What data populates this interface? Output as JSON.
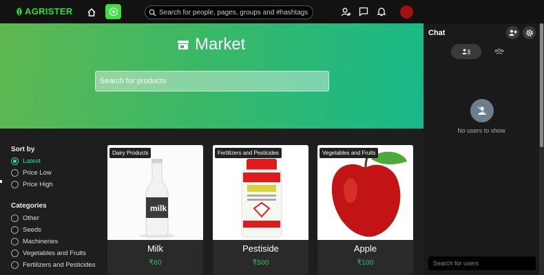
{
  "topbar": {
    "logo_text": "AGRISTER",
    "search_placeholder": "Search for people, pages, groups and #hashtags"
  },
  "hero": {
    "title": "Market",
    "search_placeholder": "Search for products"
  },
  "filters": {
    "sort_title": "Sort by",
    "sort_options": [
      "Latest",
      "Price Low",
      "Price High"
    ],
    "sort_selected": "Latest",
    "categories_title": "Categories",
    "categories": [
      "Other",
      "Seeds",
      "Machineries",
      "Vegetables and Fruits",
      "Fertilizers and Pesticides"
    ]
  },
  "products": [
    {
      "category": "Dairy Products",
      "name": "Milk",
      "price": "₹60"
    },
    {
      "category": "Fertilizers and Pesticides",
      "name": "Pestiside",
      "price": "₹500"
    },
    {
      "category": "Vegetables and Fruits",
      "name": "Apple",
      "price": "₹100"
    }
  ],
  "chat": {
    "title": "Chat",
    "empty_text": "No users to show",
    "search_placeholder": "Search for users"
  },
  "colors": {
    "brand_green": "#2ee02e",
    "accent_teal": "#2ee0a0",
    "price_green": "#2ec060",
    "avatar_red": "#a50f0f"
  },
  "icons": [
    "home-icon",
    "plus-circle-icon",
    "search-icon",
    "add-user-icon",
    "message-icon",
    "bell-icon",
    "store-icon",
    "group-add-icon",
    "gear-icon",
    "contacts-icon",
    "groups-icon",
    "no-user-icon"
  ]
}
